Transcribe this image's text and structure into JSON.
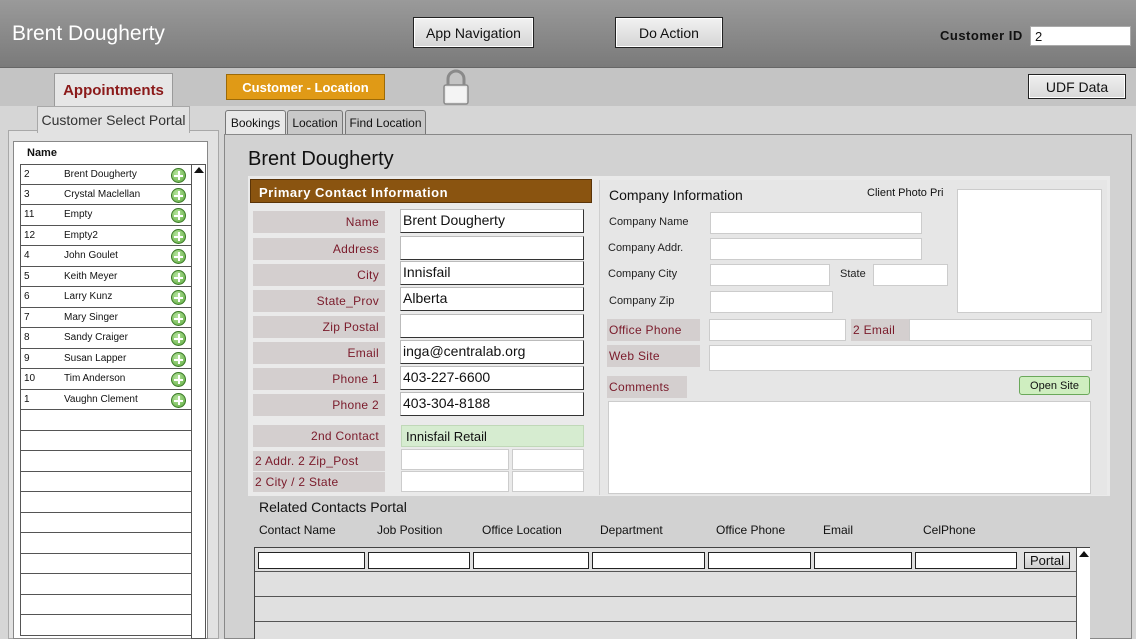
{
  "header": {
    "title": "Brent Dougherty",
    "app_nav_label": "App Navigation",
    "do_action_label": "Do Action",
    "customer_id_label": "Customer ID",
    "customer_id_value": "2"
  },
  "nav": {
    "appointments_label": "Appointments",
    "customer_location_label": "Customer - Location",
    "udf_label": "UDF Data",
    "lock_icon": "lock-icon"
  },
  "portal": {
    "tab_label": "Customer Select Portal",
    "column_header": "Name",
    "rows": [
      {
        "id": "2",
        "name": "Brent Dougherty"
      },
      {
        "id": "3",
        "name": "Crystal Maclellan"
      },
      {
        "id": "11",
        "name": "Empty"
      },
      {
        "id": "12",
        "name": "Empty2"
      },
      {
        "id": "4",
        "name": "John Goulet"
      },
      {
        "id": "5",
        "name": "Keith Meyer"
      },
      {
        "id": "6",
        "name": "Larry Kunz"
      },
      {
        "id": "7",
        "name": "Mary Singer"
      },
      {
        "id": "8",
        "name": "Sandy Craiger"
      },
      {
        "id": "9",
        "name": "Susan Lapper"
      },
      {
        "id": "10",
        "name": "Tim Anderson"
      },
      {
        "id": "1",
        "name": "Vaughn Clement"
      }
    ]
  },
  "tabs": {
    "bookings": "Bookings",
    "location": "Location",
    "find_location": "Find Location"
  },
  "main": {
    "title": "Brent Dougherty"
  },
  "primary_contact": {
    "header": "Primary Contact  Information",
    "name_label": "Name",
    "name_value": "Brent Dougherty",
    "address_label": "Address",
    "address_value": "",
    "city_label": "City",
    "city_value": "Innisfail",
    "state_label": "State_Prov",
    "state_value": "Alberta",
    "zip_label": "Zip Postal",
    "zip_value": "",
    "email_label": "Email",
    "email_value": "inga@centralab.org",
    "phone1_label": "Phone 1",
    "phone1_value": "403-227-6600",
    "phone2_label": "Phone 2",
    "phone2_value": "403-304-8188",
    "second_contact_label": "2nd  Contact",
    "second_contact_value": "Innisfail Retail",
    "addr2_label": "2 Addr. 2 Zip_Post",
    "city2_label": "2 City / 2 State"
  },
  "company": {
    "heading": "Company Information",
    "photo_label": "Client Photo Pri",
    "name_label": "Company Name",
    "addr_label": "Company Addr.",
    "city_label": "Company City",
    "state_label": "State",
    "zip_label": "Company Zip",
    "office_phone_label": "Office Phone",
    "email2_label": "2 Email",
    "website_label": "Web Site",
    "comments_label": "Comments",
    "open_site_label": "Open Site"
  },
  "related": {
    "title": "Related Contacts Portal",
    "columns": [
      "Contact Name",
      "Job Position",
      "Office Location",
      "Department",
      "Office Phone",
      "Email",
      "CelPhone"
    ],
    "portal_button": "Portal"
  },
  "colors": {
    "accent_orange": "#e09a16",
    "header_brown": "#8a5410",
    "label_maroon": "#7a1a2a",
    "label_bg": "#d4cfcf",
    "add_green": "#5aa83a"
  }
}
